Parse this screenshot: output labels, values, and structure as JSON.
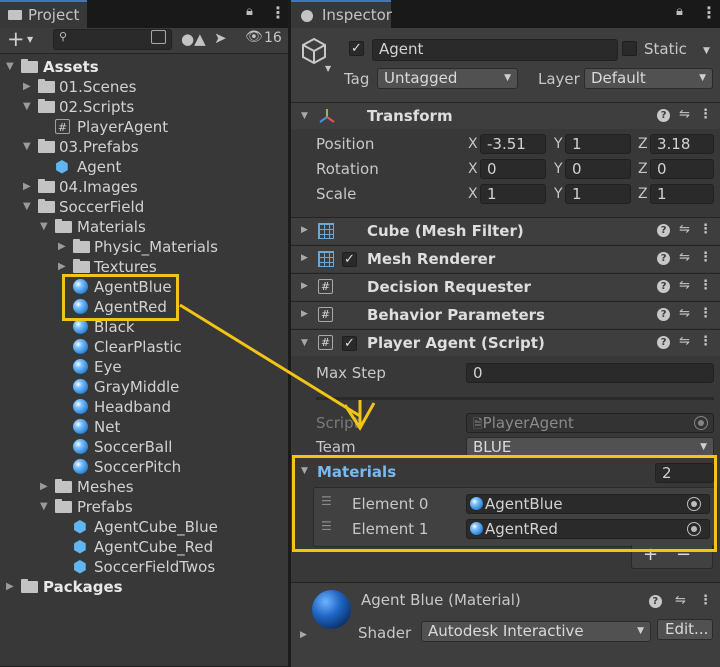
{
  "project_panel": {
    "tab_label": "Project",
    "visible_count": "16",
    "tree": [
      {
        "label": "Assets",
        "bold": true
      },
      {
        "label": "01.Scenes"
      },
      {
        "label": "02.Scripts"
      },
      {
        "label": "PlayerAgent"
      },
      {
        "label": "03.Prefabs"
      },
      {
        "label": "Agent"
      },
      {
        "label": "04.Images"
      },
      {
        "label": "SoccerField"
      },
      {
        "label": "Materials"
      },
      {
        "label": "Physic_Materials"
      },
      {
        "label": "Textures"
      },
      {
        "label": "AgentBlue"
      },
      {
        "label": "AgentRed"
      },
      {
        "label": "Black"
      },
      {
        "label": "ClearPlastic"
      },
      {
        "label": "Eye"
      },
      {
        "label": "GrayMiddle"
      },
      {
        "label": "Headband"
      },
      {
        "label": "Net"
      },
      {
        "label": "SoccerBall"
      },
      {
        "label": "SoccerPitch"
      },
      {
        "label": "Meshes"
      },
      {
        "label": "Prefabs"
      },
      {
        "label": "AgentCube_Blue"
      },
      {
        "label": "AgentCube_Red"
      },
      {
        "label": "SoccerFieldTwos"
      },
      {
        "label": "Packages",
        "bold": true
      }
    ]
  },
  "inspector": {
    "tab_label": "Inspector",
    "object_name": "Agent",
    "static_label": "Static",
    "tag_label": "Tag",
    "tag_value": "Untagged",
    "layer_label": "Layer",
    "layer_value": "Default",
    "transform": {
      "title": "Transform",
      "position_label": "Position",
      "rotation_label": "Rotation",
      "scale_label": "Scale",
      "axis_x": "X",
      "axis_y": "Y",
      "axis_z": "Z",
      "position": {
        "x": "-3.51",
        "y": "1",
        "z": "3.18"
      },
      "rotation": {
        "x": "0",
        "y": "0",
        "z": "0"
      },
      "scale": {
        "x": "1",
        "y": "1",
        "z": "1"
      }
    },
    "components": [
      {
        "title": "Cube (Mesh Filter)"
      },
      {
        "title": "Mesh Renderer"
      },
      {
        "title": "Decision Requester"
      },
      {
        "title": "Behavior Parameters"
      },
      {
        "title": "Player Agent (Script)"
      }
    ],
    "player_agent": {
      "max_step_label": "Max Step",
      "max_step_value": "0",
      "script_label": "Script",
      "script_value": "PlayerAgent",
      "team_label": "Team",
      "team_value": "BLUE"
    },
    "materials": {
      "label": "Materials",
      "count": "2",
      "elements": [
        {
          "label": "Element 0",
          "value": "AgentBlue"
        },
        {
          "label": "Element 1",
          "value": "AgentRed"
        }
      ],
      "add_symbol": "+",
      "remove_symbol": "−"
    },
    "material_preview": {
      "title": "Agent Blue (Material)",
      "shader_label": "Shader",
      "shader_value": "Autodesk Interactive",
      "edit_label": "Edit..."
    }
  },
  "annotation": {
    "highlight_color": "#f2c414"
  }
}
